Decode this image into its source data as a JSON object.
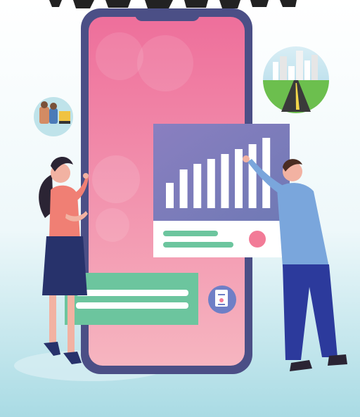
{
  "illustration": {
    "chart_panel": {
      "bar_levels": [
        0.36,
        0.55,
        0.63,
        0.7,
        0.77,
        0.84,
        0.91,
        1.0
      ]
    },
    "colors": {
      "phone_frame": "#4b4f86",
      "phone_screen_top": "#ee6f9b",
      "phone_screen_bottom": "#f6b0bd",
      "panel_purple": "#7d78b6",
      "accent_green": "#67c29a",
      "accent_pink": "#f27b97",
      "background_teal": "#bfe6ec"
    }
  }
}
